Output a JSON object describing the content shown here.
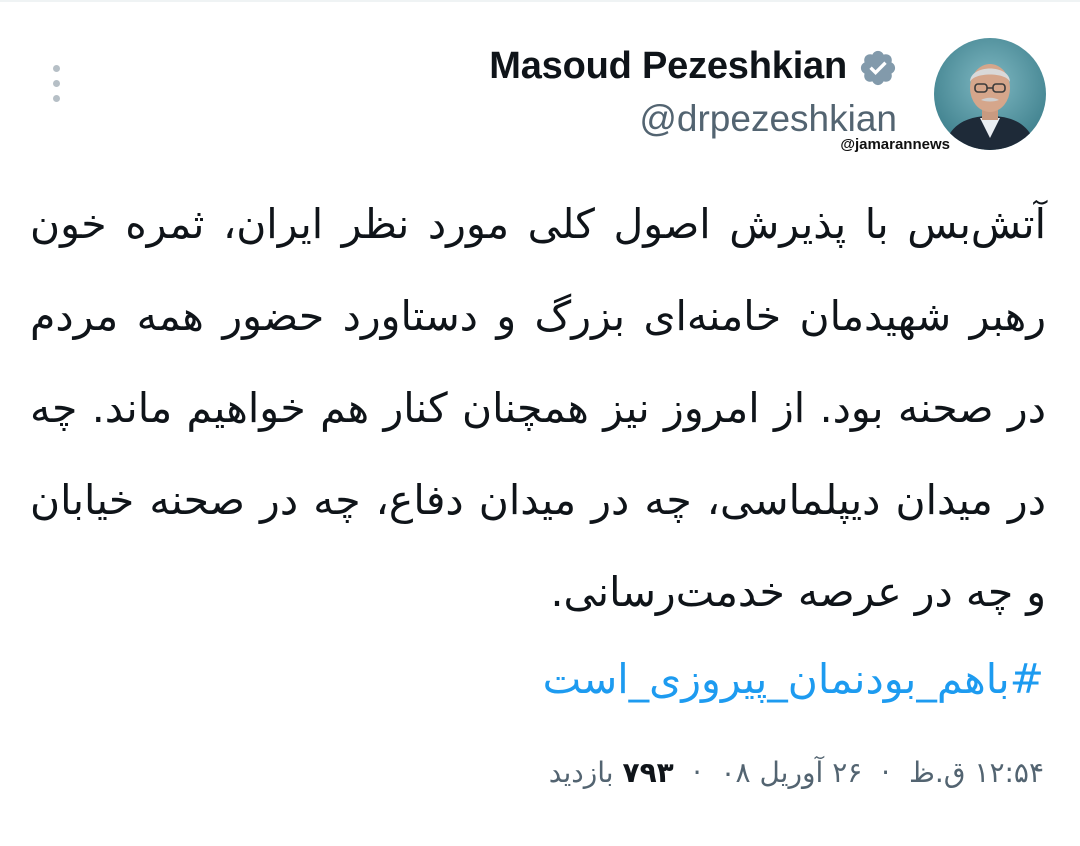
{
  "tweet": {
    "author": {
      "display_name": "Masoud Pezeshkian",
      "handle": "@drpezeshkian",
      "verified": true
    },
    "watermark": "@jamarannews",
    "text": "آتش‌بس با پذیرش اصول کلی مورد نظر ایران، ثمره خون رهبر شهیدمان خامنه‌ای بزرگ و دستاورد حضور همه مردم در صحنه بود. از امروز نیز همچنان کنار هم خواهیم ماند. چه در میدان دیپلماسی، چه در میدان دفاع، چه در صحنه خیابان و چه در عرصه خدمت‌رسانی.",
    "hashtag": "#باهم_بودنمان_پیروزی_است",
    "meta": {
      "time": "۱۲:۵۴ ق.ظ",
      "separator": "·",
      "date": "۲۶ آوریل ۰۸",
      "views_count": "۷۹۳",
      "views_label": "بازدید"
    }
  },
  "icons": {
    "more": "more-vertical-icon",
    "verified": "verified-badge-icon"
  },
  "colors": {
    "text_primary": "#0f1419",
    "text_secondary": "#536471",
    "link": "#1d9bf0",
    "verified_badge": "#829aab"
  }
}
